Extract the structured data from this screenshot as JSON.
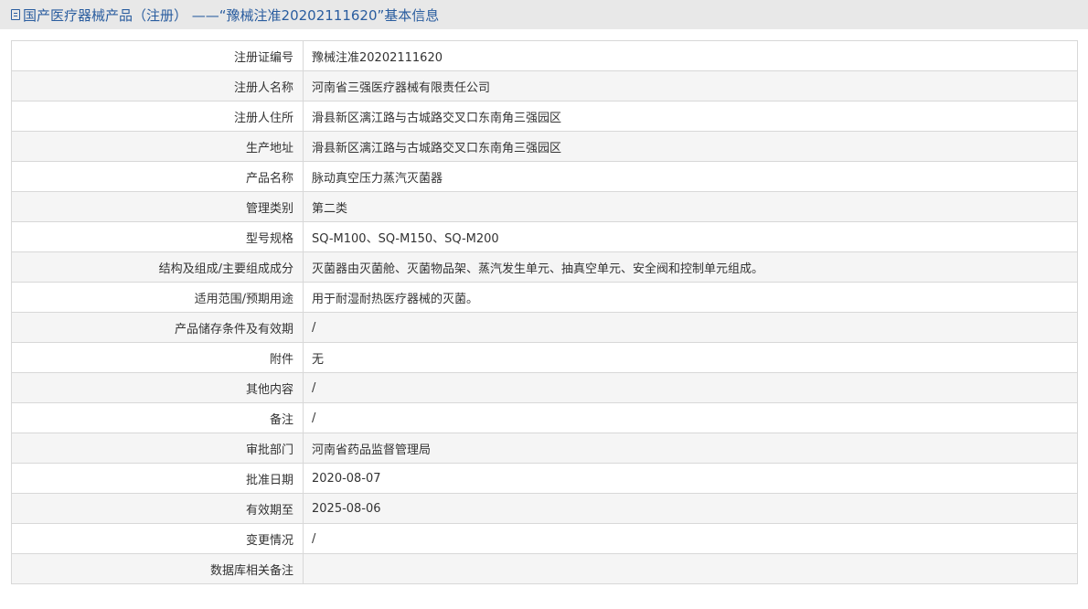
{
  "header": {
    "icon": "document-icon",
    "title": "国产医疗器械产品（注册） ——“豫械注准20202111620”基本信息"
  },
  "rows": [
    {
      "label": "注册证编号",
      "value": "豫械注准20202111620"
    },
    {
      "label": "注册人名称",
      "value": "河南省三强医疗器械有限责任公司"
    },
    {
      "label": "注册人住所",
      "value": "滑县新区漓江路与古城路交叉口东南角三强园区"
    },
    {
      "label": "生产地址",
      "value": "滑县新区漓江路与古城路交叉口东南角三强园区"
    },
    {
      "label": "产品名称",
      "value": "脉动真空压力蒸汽灭菌器"
    },
    {
      "label": "管理类别",
      "value": "第二类"
    },
    {
      "label": "型号规格",
      "value": "SQ-M100、SQ-M150、SQ-M200"
    },
    {
      "label": "结构及组成/主要组成成分",
      "value": "灭菌器由灭菌舱、灭菌物品架、蒸汽发生单元、抽真空单元、安全阀和控制单元组成。"
    },
    {
      "label": "适用范围/预期用途",
      "value": "用于耐湿耐热医疗器械的灭菌。"
    },
    {
      "label": "产品储存条件及有效期",
      "value": "/"
    },
    {
      "label": "附件",
      "value": "无"
    },
    {
      "label": "其他内容",
      "value": "/"
    },
    {
      "label": "备注",
      "value": "/"
    },
    {
      "label": "审批部门",
      "value": "河南省药品监督管理局"
    },
    {
      "label": "批准日期",
      "value": "2020-08-07"
    },
    {
      "label": "有效期至",
      "value": "2025-08-06"
    },
    {
      "label": "变更情况",
      "value": "/"
    },
    {
      "label": "数据库相关备注",
      "value": ""
    }
  ]
}
